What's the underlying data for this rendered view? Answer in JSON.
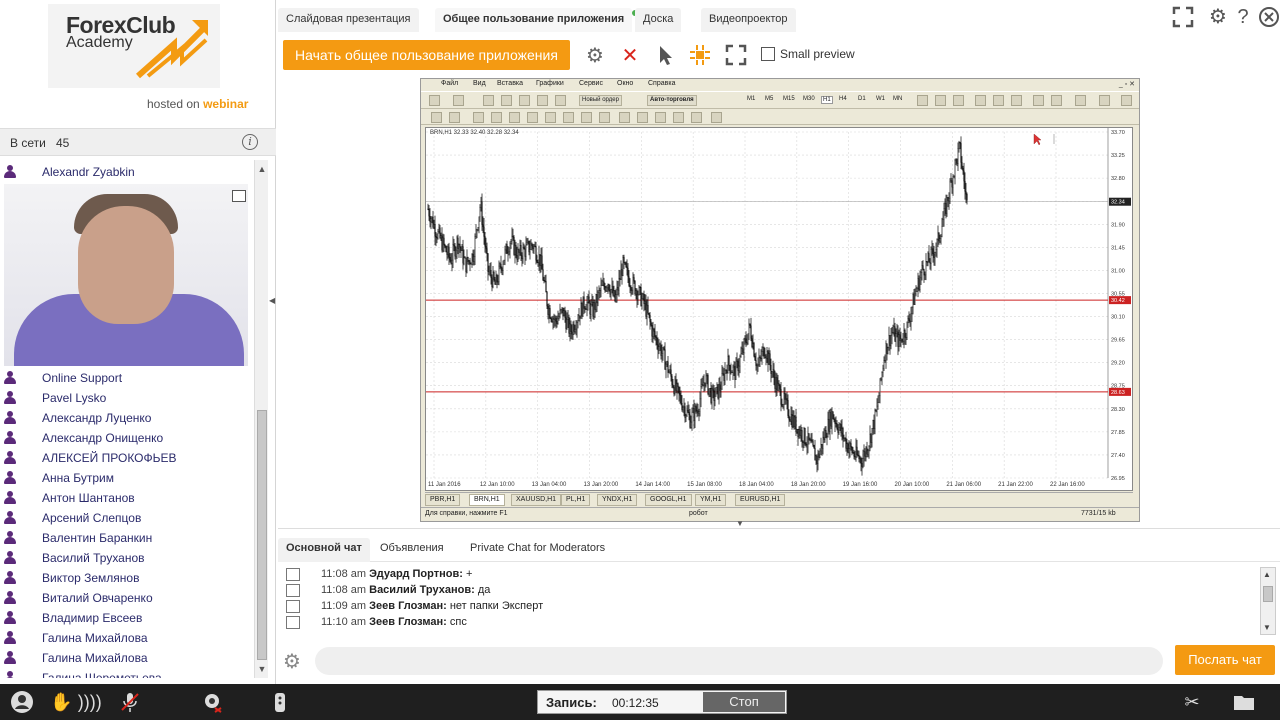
{
  "brand": {
    "logo_line1": "ForexClub",
    "logo_line2": "Academy",
    "hosted_prefix": "hosted on",
    "hosted_brand": "webinar"
  },
  "online": {
    "label": "В сети",
    "count": "45"
  },
  "presenter": "Alexandr Zyabkin",
  "users": [
    "Online Support",
    "Pavel Lysko",
    "Александр Луценко",
    "Александр Онищенко",
    "АЛЕКСЕЙ ПРОКОФЬЕВ",
    "Анна Бутрим",
    "Антон Шантанов",
    "Арсений Слепцов",
    "Валентин Баранкин",
    "Василий Труханов",
    "Виктор Землянов",
    "Виталий Овчаренко",
    "Владимир Евсеев",
    "Галина Михайлова",
    "Галина Михайлова",
    "Галина Шереметьева"
  ],
  "tabs": [
    {
      "label": "Слайдовая презентация",
      "active": false
    },
    {
      "label": "Общее пользование приложения",
      "active": true
    },
    {
      "label": "Доска",
      "active": false
    },
    {
      "label": "Видеопроектор",
      "active": false
    }
  ],
  "toolbar": {
    "share_button": "Начать общее пользование приложения",
    "small_preview_label": "Small preview",
    "small_preview_checked": false
  },
  "mt4": {
    "menu": [
      "Файл",
      "Вид",
      "Вставка",
      "Графики",
      "Сервис",
      "Окно",
      "Справка"
    ],
    "new_order": "Новый ордер",
    "auto_trading": "Авто-торговля",
    "timeframes": [
      "M1",
      "M5",
      "M15",
      "M30",
      "H1",
      "H4",
      "D1",
      "W1",
      "MN"
    ],
    "chart_header": "BRN,H1  32.33 32.40 32.28 32.34",
    "chart_tabs": [
      {
        "label": "PBR,H1",
        "active": false
      },
      {
        "label": "BRN,H1",
        "active": true
      },
      {
        "label": "XAUUSD,H1",
        "active": false
      },
      {
        "label": "PL,H1",
        "active": false
      },
      {
        "label": "YNDX,H1",
        "active": false
      },
      {
        "label": "GOOGL,H1",
        "active": false
      },
      {
        "label": "YM,H1",
        "active": false
      },
      {
        "label": "EURUSD,H1",
        "active": false
      }
    ],
    "status_help": "Для справки, нажмите F1",
    "status_profile": "робот",
    "status_traffic": "7731/15 kb"
  },
  "chart_data": {
    "type": "candlestick",
    "symbol": "BRN,H1",
    "y_ticks": [
      "33.70",
      "33.25",
      "32.80",
      "32.34",
      "31.90",
      "31.45",
      "31.00",
      "30.55",
      "30.42",
      "30.10",
      "29.65",
      "29.20",
      "28.75",
      "28.63",
      "28.30",
      "27.85",
      "27.40",
      "26.95"
    ],
    "ylim": [
      26.95,
      33.7
    ],
    "x_ticks": [
      "11 Jan 2016",
      "12 Jan 10:00",
      "13 Jan 04:00",
      "13 Jan 20:00",
      "14 Jan 14:00",
      "15 Jan 08:00",
      "18 Jan 04:00",
      "18 Jan 20:00",
      "19 Jan 16:00",
      "20 Jan 10:00",
      "21 Jan 06:00",
      "21 Jan 22:00",
      "22 Jan 16:00"
    ],
    "current_price": "32.34",
    "horizontal_lines": [
      {
        "value": "30.42",
        "color": "#cc2222"
      },
      {
        "value": "28.63",
        "color": "#cc2222"
      }
    ],
    "path_close": [
      32.2,
      31.8,
      31.5,
      31.2,
      31.6,
      31.1,
      31.3,
      32.3,
      31.0,
      30.7,
      31.2,
      31.6,
      31.3,
      31.4,
      31.5,
      31.2,
      30.3,
      30.0,
      30.2,
      29.8,
      30.1,
      30.4,
      30.2,
      30.6,
      30.8,
      30.4,
      31.1,
      30.8,
      30.6,
      30.3,
      29.8,
      29.5,
      29.1,
      28.7,
      28.4,
      28.1,
      28.3,
      28.9,
      28.5,
      28.7,
      29.2,
      29.0,
      29.4,
      29.9,
      29.1,
      29.5,
      29.0,
      28.6,
      28.3,
      28.0,
      27.8,
      27.6,
      27.3,
      27.8,
      28.2,
      27.9,
      27.6,
      27.4,
      27.3,
      27.7,
      28.3,
      29.4,
      29.8,
      29.6,
      29.9,
      30.5,
      31.0,
      31.2,
      31.5,
      32.1,
      32.8,
      33.4,
      32.3
    ]
  },
  "chat": {
    "tabs": [
      {
        "label": "Основной чат",
        "active": true
      },
      {
        "label": "Объявления",
        "active": false
      },
      {
        "label": "Private Chat for Moderators",
        "active": false
      }
    ],
    "messages": [
      {
        "time": "11:08 am",
        "author": "Эдуард Портнов:",
        "text": "+"
      },
      {
        "time": "11:08 am",
        "author": "Василий Труханов:",
        "text": "да"
      },
      {
        "time": "11:09 am",
        "author": "Зеев Глозман:",
        "text": "нет папки Эксперт"
      },
      {
        "time": "11:10 am",
        "author": "Зеев Глозман:",
        "text": "спс"
      }
    ],
    "input_placeholder": "",
    "send_button": "Послать чат"
  },
  "recording": {
    "label": "Запись:",
    "time": "00:12:35",
    "stop_button": "Стоп"
  },
  "icons": {
    "fullscreen": "fullscreen-icon",
    "settings": "gear-icon",
    "help": "help-icon",
    "close": "close-icon"
  },
  "colors": {
    "accent": "#f49a12",
    "user_icon": "#5b2a7a",
    "bottom_bar": "#1f1f1f",
    "stop_red": "#d9251c"
  }
}
